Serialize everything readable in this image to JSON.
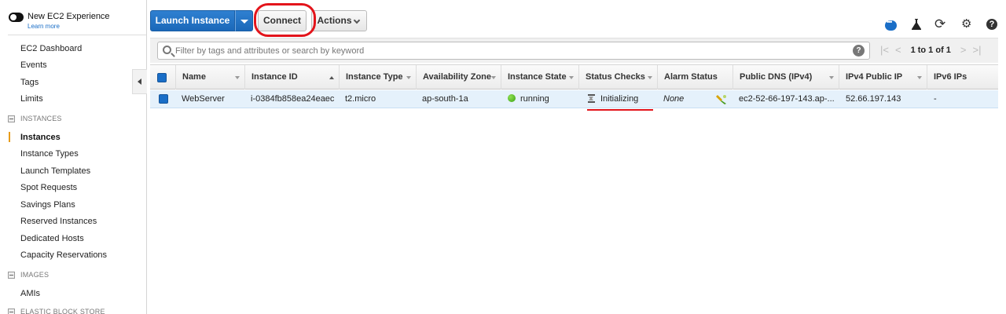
{
  "sidebar": {
    "toggle_title": "New EC2 Experience",
    "toggle_link": "Learn more",
    "items": [
      "EC2 Dashboard",
      "Events",
      "Tags",
      "Limits"
    ],
    "sections": [
      {
        "title": "INSTANCES",
        "items": [
          "Instances",
          "Instance Types",
          "Launch Templates",
          "Spot Requests",
          "Savings Plans",
          "Reserved Instances",
          "Dedicated Hosts",
          "Capacity Reservations"
        ]
      },
      {
        "title": "IMAGES",
        "items": [
          "AMIs"
        ]
      },
      {
        "title": "ELASTIC BLOCK STORE",
        "items": []
      }
    ],
    "active_item": "Instances"
  },
  "toolbar": {
    "launch_label": "Launch Instance",
    "connect_label": "Connect",
    "actions_label": "Actions"
  },
  "icons": {
    "help": "?"
  },
  "filter": {
    "placeholder": "Filter by tags and attributes or search by keyword",
    "help": "?"
  },
  "pager": {
    "first": "|<",
    "prev": "<",
    "count": "1 to 1 of 1",
    "next": ">",
    "last": ">|"
  },
  "table": {
    "columns": [
      "Name",
      "Instance ID",
      "Instance Type",
      "Availability Zone",
      "Instance State",
      "Status Checks",
      "Alarm Status",
      "Public DNS (IPv4)",
      "IPv4 Public IP",
      "IPv6 IPs"
    ],
    "rows": [
      {
        "name": "WebServer",
        "instance_id": "i-0384fb858ea24eaec",
        "instance_type": "t2.micro",
        "availability_zone": "ap-south-1a",
        "instance_state": "running",
        "status_checks": "Initializing",
        "alarm_status": "None",
        "public_dns": "ec2-52-66-197-143.ap-...",
        "ipv4_public_ip": "52.66.197.143",
        "ipv6_ips": "-"
      }
    ]
  },
  "colors": {
    "primary_button": "#1a6ec7",
    "highlight": "#e3141b",
    "running": "#3ba314",
    "selected_row": "#e5f1fb",
    "active_nav": "#e79c1b"
  }
}
